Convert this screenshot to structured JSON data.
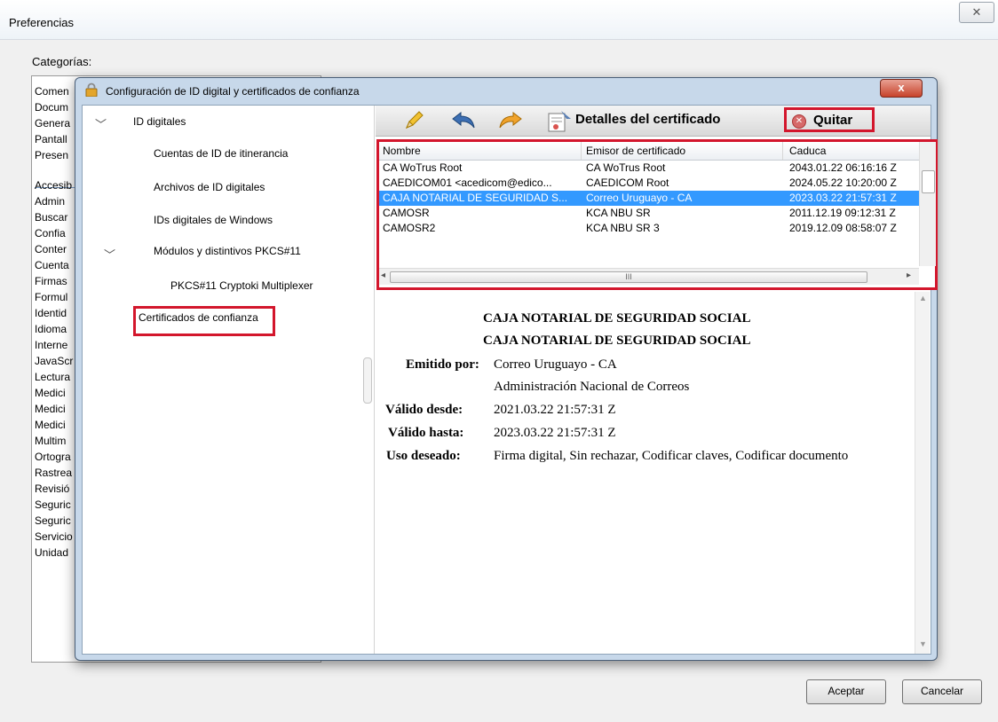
{
  "preferences": {
    "title": "Preferencias",
    "close_icon": "✕",
    "categories_label": "Categorías:",
    "categories": [
      "Comen",
      "Docum",
      "Genera",
      "Pantall",
      "Presen",
      "Accesib",
      "Admin",
      "Buscar",
      "Confia",
      "Conter",
      "Cuenta",
      "Firmas",
      "Formul",
      "Identid",
      "Idioma",
      "Interne",
      "JavaScr",
      "Lectura",
      "Medici",
      "Medici",
      "Medici",
      "Multim",
      "Ortogra",
      "Rastrea",
      "Revisió",
      "Seguric",
      "Seguric",
      "Servicio",
      "Unidad"
    ],
    "ok_label": "Aceptar",
    "cancel_label": "Cancelar"
  },
  "dialog": {
    "title": "Configuración de ID digital y certificados de confianza",
    "close_label": "x",
    "tree": {
      "id_digitales": "ID digitales",
      "cuentas_itinerancia": "Cuentas de ID de itinerancia",
      "archivos_id": "Archivos de ID digitales",
      "ids_windows": "IDs digitales de Windows",
      "modulos_pkcs": "Módulos y distintivos PKCS#11",
      "pkcs_cryptoki": "PKCS#11 Cryptoki Multiplexer",
      "certificados_confianza": "Certificados de confianza"
    },
    "toolbar": {
      "details_label": "Detalles del certificado",
      "remove_label": "Quitar"
    },
    "table": {
      "columns": [
        "Nombre",
        "Emisor de certificado",
        "Caduca"
      ],
      "rows": [
        {
          "name": "CA WoTrus Root",
          "issuer": "CA WoTrus Root",
          "expires": "2043.01.22 06:16:16 Z",
          "selected": false
        },
        {
          "name": "CAEDICOM01 <acedicom@edico...",
          "issuer": "CAEDICOM Root",
          "expires": "2024.05.22 10:20:00 Z",
          "selected": false
        },
        {
          "name": "CAJA NOTARIAL DE SEGURIDAD S...",
          "issuer": "Correo Uruguayo - CA",
          "expires": "2023.03.22 21:57:31 Z",
          "selected": true
        },
        {
          "name": "CAMOSR",
          "issuer": "KCA NBU SR",
          "expires": "2011.12.19 09:12:31 Z",
          "selected": false
        },
        {
          "name": "CAMOSR2",
          "issuer": "KCA NBU SR 3",
          "expires": "2019.12.09 08:58:07 Z",
          "selected": false
        }
      ],
      "hscroll_grip": "III"
    },
    "details": {
      "title1": "CAJA NOTARIAL DE SEGURIDAD SOCIAL",
      "title2": "CAJA NOTARIAL DE SEGURIDAD SOCIAL",
      "issued_by_label": "Emitido por:",
      "issued_by_1": "Correo Uruguayo - CA",
      "issued_by_2": "Administración Nacional de Correos",
      "valid_from_label": "Válido desde:",
      "valid_from": "2021.03.22 21:57:31 Z",
      "valid_to_label": "Válido hasta:",
      "valid_to": "2023.03.22 21:57:31 Z",
      "usage_label": "Uso deseado:",
      "usage": "Firma digital, Sin rechazar, Codificar claves, Codificar documento"
    }
  }
}
